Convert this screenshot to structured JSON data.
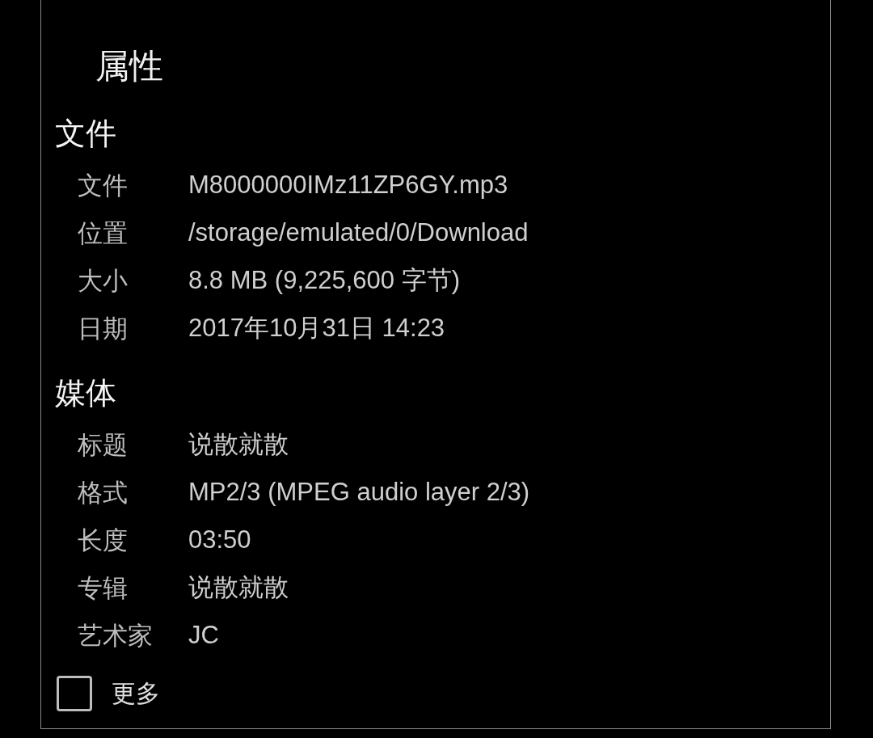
{
  "dialog": {
    "title": "属性"
  },
  "sections": [
    {
      "heading": "文件",
      "rows": [
        {
          "label": "文件",
          "value": "M8000000IMz11ZP6GY.mp3"
        },
        {
          "label": "位置",
          "value": "/storage/emulated/0/Download"
        },
        {
          "label": "大小",
          "value": "8.8 MB (9,225,600 字节)"
        },
        {
          "label": "日期",
          "value": "2017年10月31日 14:23"
        }
      ]
    },
    {
      "heading": "媒体",
      "rows": [
        {
          "label": "标题",
          "value": "说散就散"
        },
        {
          "label": "格式",
          "value": "MP2/3 (MPEG audio layer 2/3)"
        },
        {
          "label": "长度",
          "value": "03:50"
        },
        {
          "label": "专辑",
          "value": "说散就散"
        },
        {
          "label": "艺术家",
          "value": "JC"
        }
      ]
    }
  ],
  "more": {
    "label": "更多",
    "checked": false
  }
}
